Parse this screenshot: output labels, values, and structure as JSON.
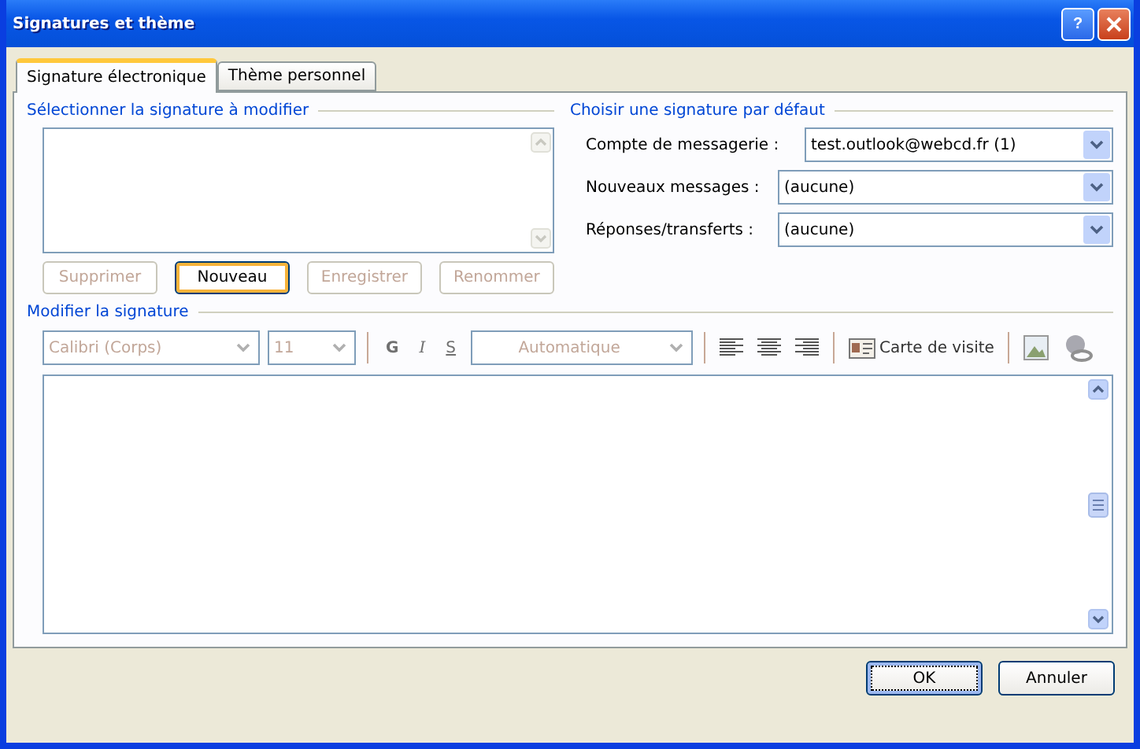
{
  "window": {
    "title": "Signatures et thème",
    "help": "?"
  },
  "tabs": [
    {
      "label": "Signature électronique",
      "selected": true
    },
    {
      "label": "Thème personnel",
      "selected": false
    }
  ],
  "select_section": {
    "title": "Sélectionner la signature à modifier",
    "buttons": [
      {
        "label": "Supprimer",
        "disabled": true,
        "hovered": false
      },
      {
        "label": "Nouveau",
        "disabled": false,
        "hovered": true
      },
      {
        "label": "Enregistrer",
        "disabled": true,
        "hovered": false
      },
      {
        "label": "Renommer",
        "disabled": true,
        "hovered": false
      }
    ]
  },
  "default_section": {
    "title": "Choisir une signature par défaut",
    "fields": [
      {
        "label": "Compte de messagerie :",
        "value": "test.outlook@webcd.fr (1)"
      },
      {
        "label": "Nouveaux messages :",
        "value": "(aucune)"
      },
      {
        "label": "Réponses/transferts :",
        "value": "(aucune)"
      }
    ]
  },
  "edit_section": {
    "title": "Modifier la signature",
    "font": "Calibri (Corps)",
    "size": "11",
    "bold": "G",
    "italic": "I",
    "underline": "S",
    "text_color_option": "Automatique",
    "business_card": "Carte de visite"
  },
  "buttons": [
    {
      "label": "OK",
      "default": true
    },
    {
      "label": "Annuler",
      "default": false
    }
  ]
}
